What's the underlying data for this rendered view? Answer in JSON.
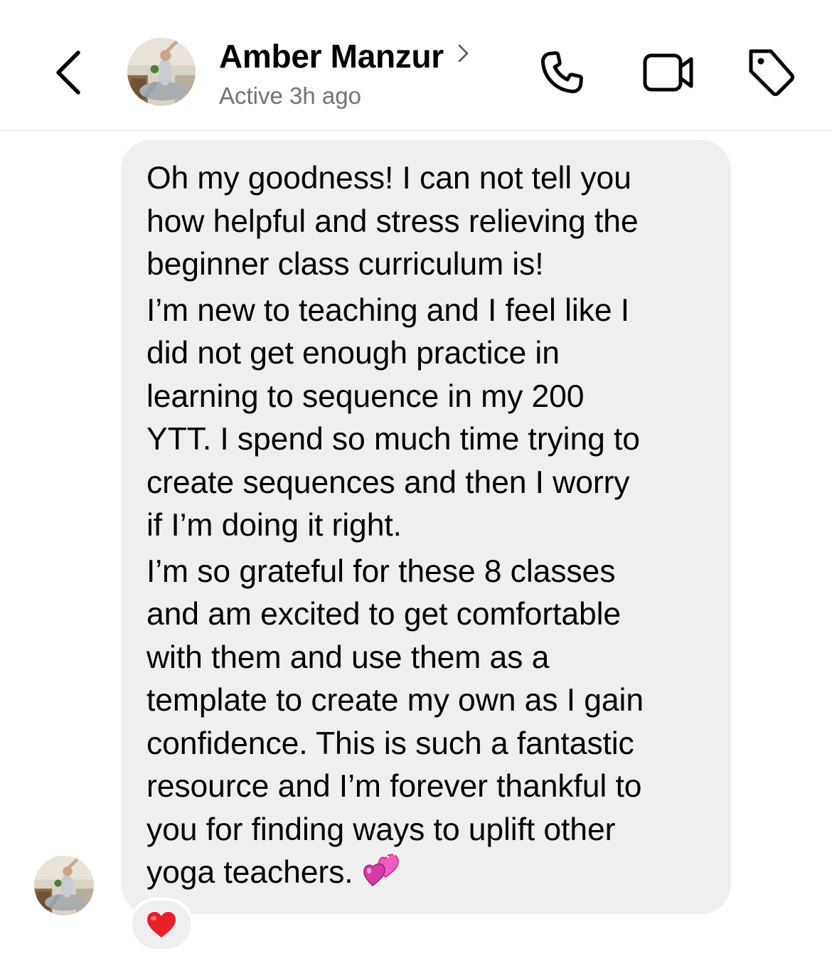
{
  "header": {
    "back_icon": "chevron-left-icon",
    "contact_name": "Amber Manzur",
    "status": "Active 3h ago",
    "actions": [
      {
        "name": "call",
        "icon": "phone-icon"
      },
      {
        "name": "video",
        "icon": "video-camera-icon"
      },
      {
        "name": "tag",
        "icon": "tag-icon"
      }
    ]
  },
  "message": {
    "paragraphs": [
      "Oh my goodness! I can not tell you\nhow helpful and stress relieving the\nbeginner class curriculum is!",
      "I’m new to teaching and I feel like I\ndid not get enough practice in\nlearning to sequence in my 200\nYTT. I spend so much time trying to\ncreate sequences and then I worry\nif I’m doing it right.",
      "I’m so grateful for these 8 classes\nand am excited to get comfortable\nwith them and use them as a\ntemplate to create my own as I gain\nconfidence. This is such a fantastic\nresource and I’m forever thankful to\nyou for finding ways to uplift other\nyoga teachers."
    ],
    "end_emoji": "two-hearts-icon",
    "reaction": "red-heart-icon"
  },
  "colors": {
    "bubble_bg": "#efefef",
    "status_text": "#737373",
    "divider": "#dcdcdc",
    "heart_red": "#e8202a",
    "heart_pink": "#e040a8"
  }
}
